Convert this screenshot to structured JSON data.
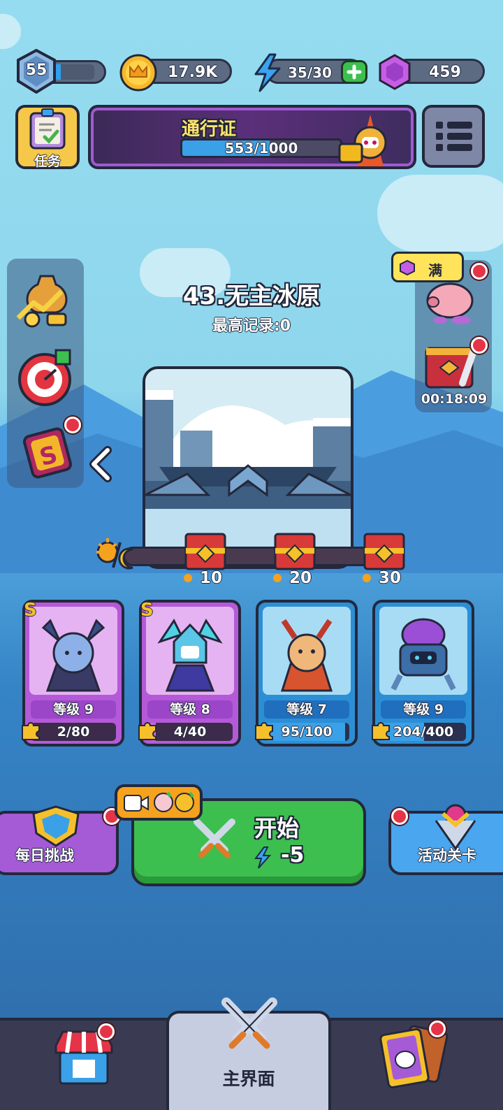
{
  "top_bar": {
    "level": "55",
    "level_progress": 0.2,
    "coins": "17.9K",
    "energy": "35/30",
    "gems": "459"
  },
  "tasks": {
    "label": "任务"
  },
  "pass": {
    "title": "通行证",
    "progress_text": "553/1000",
    "progress": 0.553
  },
  "piggy": {
    "label": "满"
  },
  "chest_timer": "00:18:09",
  "stage": {
    "title": "43.无主冰原",
    "record": "最高记录:0"
  },
  "milestones": [
    {
      "label": "10"
    },
    {
      "label": "20"
    },
    {
      "label": "30"
    }
  ],
  "heroes": [
    {
      "rank": "S",
      "level": "等级 9",
      "progress_text": "2/80",
      "progress": 0.025,
      "style": "purple"
    },
    {
      "rank": "S",
      "level": "等级 8",
      "progress_text": "4/40",
      "progress": 0.1,
      "style": "purple"
    },
    {
      "rank": "",
      "level": "等级 7",
      "progress_text": "95/100",
      "progress": 0.95,
      "style": "blue"
    },
    {
      "rank": "",
      "level": "等级 9",
      "progress_text": "204/400",
      "progress": 0.51,
      "style": "blue"
    }
  ],
  "actions": {
    "daily_challenge": "每日挑战",
    "start": "开始",
    "start_cost": "-5",
    "event_stage": "活动关卡"
  },
  "nav": {
    "main": "主界面"
  },
  "colors": {
    "accent_green": "#3cbf4e",
    "accent_purple": "#a55ad6",
    "accent_blue": "#3aa0e8",
    "badge_red": "#e53447"
  }
}
